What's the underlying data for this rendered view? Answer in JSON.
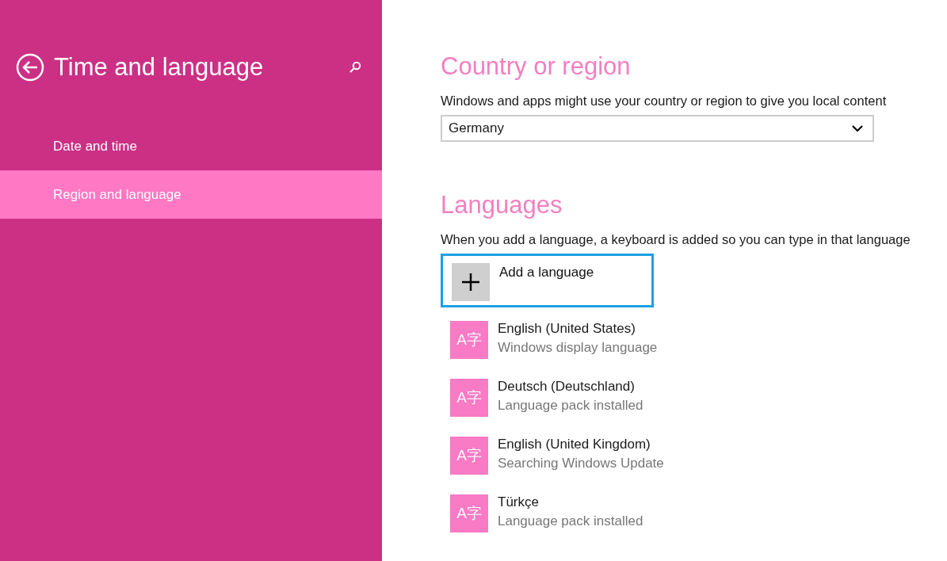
{
  "sidebar": {
    "title": "Time and language",
    "items": [
      {
        "label": "Date and time",
        "selected": false
      },
      {
        "label": "Region and language",
        "selected": true
      }
    ]
  },
  "country": {
    "heading": "Country or region",
    "description": "Windows and apps might use your country or region to give you local content",
    "value": "Germany"
  },
  "languages": {
    "heading": "Languages",
    "description": "When you add a language, a keyboard is added so you can type in that language",
    "add_button": {
      "label": "Add a language",
      "focused": true
    },
    "items": [
      {
        "icon_text": "A字",
        "name": "English (United States)",
        "status": "Windows display language"
      },
      {
        "icon_text": "A字",
        "name": "Deutsch (Deutschland)",
        "status": "Language pack installed"
      },
      {
        "icon_text": "A字",
        "name": "English (United Kingdom)",
        "status": "Searching Windows Update"
      },
      {
        "icon_text": "A字",
        "name": "Türkçe",
        "status": "Language pack installed"
      }
    ]
  }
}
